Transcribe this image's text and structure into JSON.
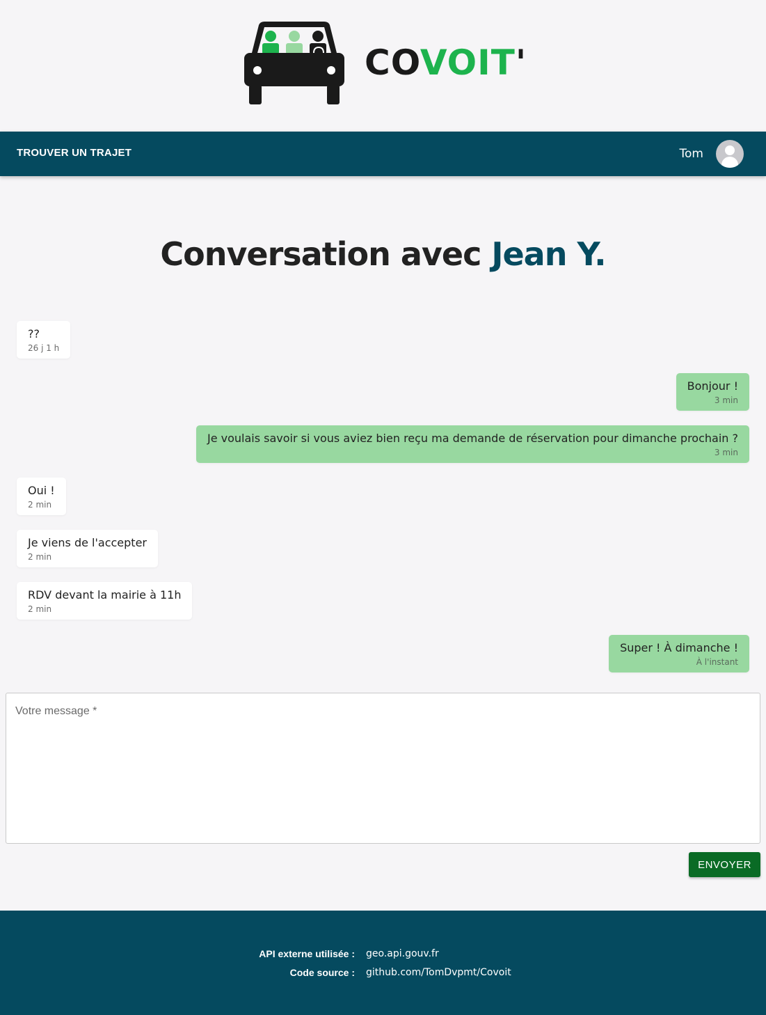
{
  "brand": {
    "name_black_1": "CO",
    "name_green": "VOIT",
    "name_black_2": "'"
  },
  "nav": {
    "find_ride": "TROUVER UN TRAJET",
    "user_name": "Tom"
  },
  "page": {
    "title_prefix": "Conversation avec",
    "title_name": "Jean Y."
  },
  "messages": [
    {
      "text": "??",
      "time": "26 j 1 h",
      "direction": "in"
    },
    {
      "text": "Bonjour !",
      "time": "3 min",
      "direction": "out"
    },
    {
      "text": "Je voulais savoir si vous aviez bien reçu ma demande de réservation pour dimanche prochain ?",
      "time": "3 min",
      "direction": "out"
    },
    {
      "text": "Oui !",
      "time": "2 min",
      "direction": "in"
    },
    {
      "text": "Je viens de l'accepter",
      "time": "2 min",
      "direction": "in"
    },
    {
      "text": "RDV devant la mairie à 11h",
      "time": "2 min",
      "direction": "in"
    },
    {
      "text": "Super ! À dimanche !",
      "time": "À l'instant",
      "direction": "out"
    }
  ],
  "composer": {
    "label": "Votre message *",
    "value": "",
    "send_label": "ENVOYER"
  },
  "footer": {
    "api_label": "API externe utilisée :",
    "api_value": "geo.api.gouv.fr",
    "source_label": "Code source :",
    "source_value": "github.com/TomDvpmt/Covoit"
  },
  "colors": {
    "primary": "#054a5f",
    "outgoing_bubble": "#98d8a0",
    "send_button": "#0a6b25",
    "brand_green": "#1db34d"
  }
}
